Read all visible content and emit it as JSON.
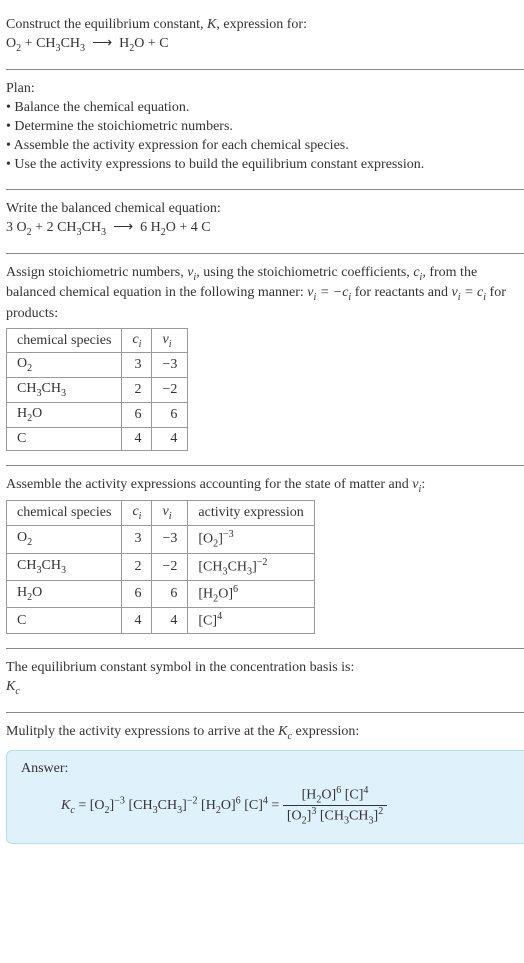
{
  "prompt": {
    "line1": "Construct the equilibrium constant, ",
    "K": "K",
    "line1b": ", expression for:"
  },
  "plan": {
    "heading": "Plan:",
    "items": [
      "• Balance the chemical equation.",
      "• Determine the stoichiometric numbers.",
      "• Assemble the activity expression for each chemical species.",
      "• Use the activity expressions to build the equilibrium constant expression."
    ]
  },
  "balanced": {
    "heading": "Write the balanced chemical equation:"
  },
  "stoich": {
    "text1": "Assign stoichiometric numbers, ",
    "nu": "ν",
    "text2": ", using the stoichiometric coefficients, ",
    "c": "c",
    "text3": ", from the balanced chemical equation in the following manner: ",
    "rel1a": "ν",
    "rel1b": " = −c",
    "rel1c": " for reactants and ",
    "rel2a": "ν",
    "rel2b": " = c",
    "rel2c": " for products:"
  },
  "table1": {
    "h1": "chemical species",
    "h2": "c",
    "h3": "ν",
    "rows": [
      {
        "c": "3",
        "nu": "−3"
      },
      {
        "c": "2",
        "nu": "−2"
      },
      {
        "c": "6",
        "nu": "6"
      },
      {
        "c": "4",
        "nu": "4"
      }
    ]
  },
  "assemble": {
    "text1": "Assemble the activity expressions accounting for the state of matter and ",
    "nu": "ν",
    "text2": ":"
  },
  "table2": {
    "h1": "chemical species",
    "h2": "c",
    "h3": "ν",
    "h4": "activity expression",
    "rows": [
      {
        "c": "3",
        "nu": "−3"
      },
      {
        "c": "2",
        "nu": "−2"
      },
      {
        "c": "6",
        "nu": "6"
      },
      {
        "c": "4",
        "nu": "4"
      }
    ]
  },
  "symbol": {
    "line1": "The equilibrium constant symbol in the concentration basis is:",
    "Kc": "K"
  },
  "multiply": {
    "text1": "Mulitply the activity expressions to arrive at the ",
    "text2": " expression:"
  },
  "answer": {
    "label": "Answer:"
  },
  "chart_data": {
    "type": "table",
    "tables": [
      {
        "columns": [
          "chemical species",
          "c_i",
          "ν_i"
        ],
        "rows": [
          [
            "O2",
            3,
            -3
          ],
          [
            "CH3CH3",
            2,
            -2
          ],
          [
            "H2O",
            6,
            6
          ],
          [
            "C",
            4,
            4
          ]
        ]
      },
      {
        "columns": [
          "chemical species",
          "c_i",
          "ν_i",
          "activity expression"
        ],
        "rows": [
          [
            "O2",
            3,
            -3,
            "[O2]^-3"
          ],
          [
            "CH3CH3",
            2,
            -2,
            "[CH3CH3]^-2"
          ],
          [
            "H2O",
            6,
            6,
            "[H2O]^6"
          ],
          [
            "C",
            4,
            4,
            "[C]^4"
          ]
        ]
      }
    ],
    "equations": {
      "unbalanced": "O2 + CH3CH3 -> H2O + C",
      "balanced": "3 O2 + 2 CH3CH3 -> 6 H2O + 4 C",
      "Kc": "Kc = [O2]^-3 [CH3CH3]^-2 [H2O]^6 [C]^4 = ([H2O]^6 [C]^4) / ([O2]^3 [CH3CH3]^2)"
    }
  }
}
